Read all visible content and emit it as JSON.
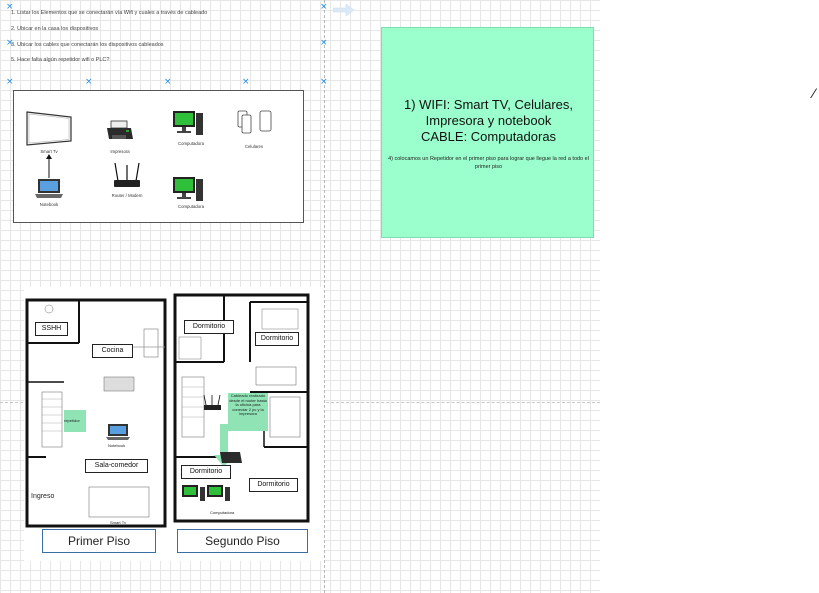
{
  "tasks": [
    "1. Listar los Elementos que se conectarán vía Wifi y cuales a través de cableado",
    "2. Ubicar en la casa los dispositivos",
    "3. Ubicar los cables que conectarán los dispositivos cableados",
    "5. Hace falta algún repetidor wifi o PLC?"
  ],
  "devices": {
    "smart_tv": "Smart Tv",
    "impresora": "Impresora",
    "computadora_1": "Computadora",
    "celulares": "Celulares",
    "notebook": "Notebook",
    "router": "Router / Modem",
    "computadora_2": "Computadora"
  },
  "answer": {
    "line1": "1) WIFI: Smart TV, Celulares,",
    "line2": "Impresora y notebook",
    "line3": "CABLE: Computadoras",
    "note": "4) colocamos un Repetidor en el primer piso para lograr que llegue la red a todo el primer piso"
  },
  "floorplan": {
    "rooms": {
      "sshh": "SSHH",
      "cocina": "Cocina",
      "sala_comedor": "Sala-comedor",
      "ingreso": "Ingreso",
      "dormitorio_1": "Dormitorio",
      "dormitorio_2": "Dormitorio",
      "dormitorio_3": "Dormitorio",
      "dormitorio_4": "Dormitorio"
    },
    "repeater_label": "repetidor",
    "notebook_label": "Notebook",
    "smart_tv_label": "Smart Tv",
    "computadora_label": "Computadora",
    "cable_note": "Cableado realizado desde el router hasta la oficina para conectar 2 pc y la impresora",
    "primer_piso": "Primer Piso",
    "segundo_piso": "Segundo Piso"
  },
  "colors": {
    "answer_bg": "#9affcc",
    "green_note": "#8fe3b4",
    "selection_blue": "#1c8de8"
  }
}
